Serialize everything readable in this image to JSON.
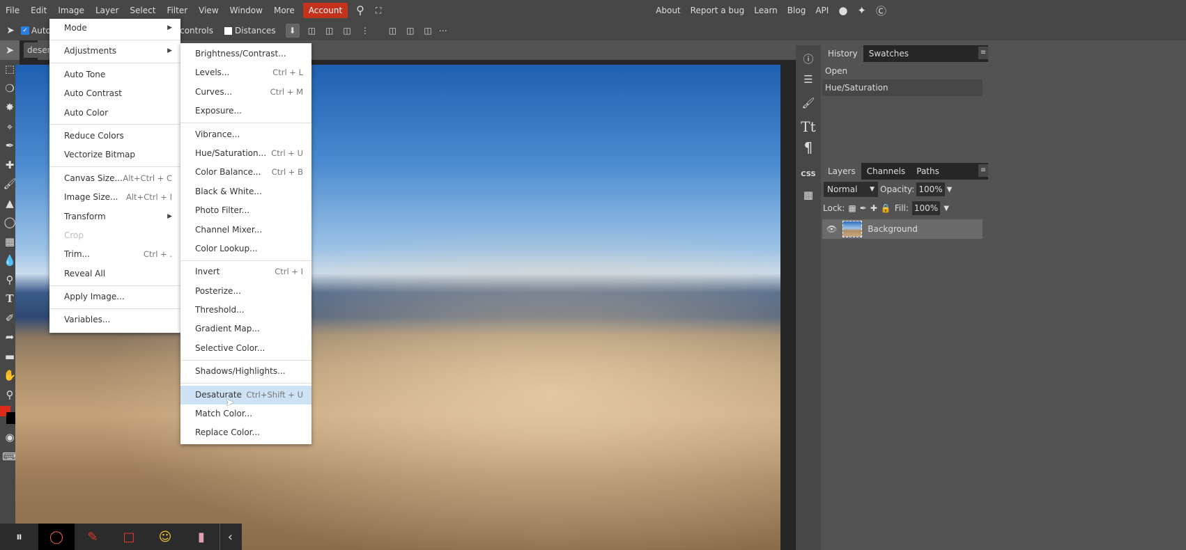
{
  "menubar": {
    "items": [
      "File",
      "Edit",
      "Image",
      "Layer",
      "Select",
      "Filter",
      "View",
      "Window",
      "More"
    ],
    "account": "Account"
  },
  "toplinks": [
    "About",
    "Report a bug",
    "Learn",
    "Blog",
    "API"
  ],
  "options": {
    "auto_select": "Auto",
    "transform_controls": "rm controls",
    "distances": "Distances"
  },
  "doc_tab": "deser",
  "image_menu": [
    {
      "label": "Mode",
      "submenu": true
    },
    {
      "sep": true
    },
    {
      "label": "Adjustments",
      "submenu": true
    },
    {
      "sep": true
    },
    {
      "label": "Auto Tone"
    },
    {
      "label": "Auto Contrast"
    },
    {
      "label": "Auto Color"
    },
    {
      "sep": true
    },
    {
      "label": "Reduce Colors"
    },
    {
      "label": "Vectorize Bitmap"
    },
    {
      "sep": true
    },
    {
      "label": "Canvas Size...",
      "shortcut": "Alt+Ctrl + C"
    },
    {
      "label": "Image Size...",
      "shortcut": "Alt+Ctrl + I"
    },
    {
      "label": "Transform",
      "submenu": true
    },
    {
      "label": "Crop",
      "disabled": true
    },
    {
      "label": "Trim...",
      "shortcut": "Ctrl + ."
    },
    {
      "label": "Reveal All"
    },
    {
      "sep": true
    },
    {
      "label": "Apply Image..."
    },
    {
      "sep": true
    },
    {
      "label": "Variables..."
    }
  ],
  "adjust_menu": [
    {
      "label": "Brightness/Contrast..."
    },
    {
      "label": "Levels...",
      "shortcut": "Ctrl + L"
    },
    {
      "label": "Curves...",
      "shortcut": "Ctrl + M"
    },
    {
      "label": "Exposure..."
    },
    {
      "sep": true
    },
    {
      "label": "Vibrance..."
    },
    {
      "label": "Hue/Saturation...",
      "shortcut": "Ctrl + U"
    },
    {
      "label": "Color Balance...",
      "shortcut": "Ctrl + B"
    },
    {
      "label": "Black & White..."
    },
    {
      "label": "Photo Filter..."
    },
    {
      "label": "Channel Mixer..."
    },
    {
      "label": "Color Lookup..."
    },
    {
      "sep": true
    },
    {
      "label": "Invert",
      "shortcut": "Ctrl + I"
    },
    {
      "label": "Posterize..."
    },
    {
      "label": "Threshold..."
    },
    {
      "label": "Gradient Map..."
    },
    {
      "label": "Selective Color..."
    },
    {
      "sep": true
    },
    {
      "label": "Shadows/Highlights..."
    },
    {
      "sep": true
    },
    {
      "label": "Desaturate",
      "shortcut": "Ctrl+Shift + U",
      "highlighted": true
    },
    {
      "label": "Match Color..."
    },
    {
      "label": "Replace Color..."
    }
  ],
  "history": {
    "tabs": [
      "History",
      "Swatches"
    ],
    "items": [
      "Open",
      "Hue/Saturation"
    ]
  },
  "layers": {
    "tabs": [
      "Layers",
      "Channels",
      "Paths"
    ],
    "blend": "Normal",
    "opacity_label": "Opacity:",
    "opacity": "100%",
    "lock_label": "Lock:",
    "fill_label": "Fill:",
    "fill": "100%",
    "items": [
      "Background"
    ]
  },
  "colors": {
    "accent": "#c4321c",
    "foreground": "#e02a1a",
    "background": "#000000"
  }
}
